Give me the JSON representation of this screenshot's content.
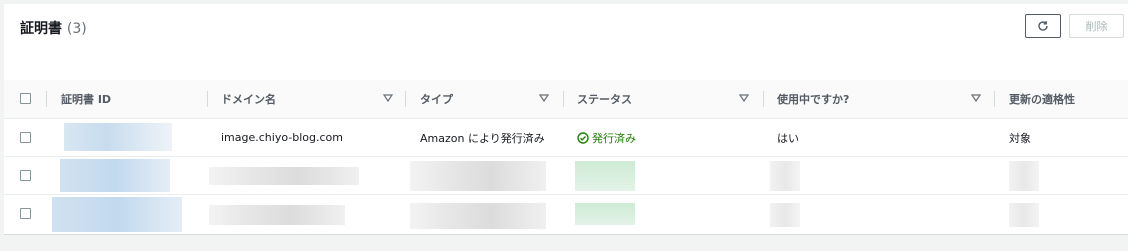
{
  "panel": {
    "title": "証明書",
    "count": "(3)",
    "refresh_icon": "refresh-icon",
    "delete_label": "削除"
  },
  "table": {
    "columns": [
      {
        "label": "証明書 ID",
        "sortable": false
      },
      {
        "label": "ドメイン名",
        "sortable": true
      },
      {
        "label": "タイプ",
        "sortable": true
      },
      {
        "label": "ステータス",
        "sortable": true
      },
      {
        "label": "使用中ですか?",
        "sortable": true
      },
      {
        "label": "更新の適格性",
        "sortable": false
      }
    ],
    "rows": [
      {
        "certificate_id": "",
        "domain": "image.chiyo-blog.com",
        "type": "Amazon により発行済み",
        "status": "発行済み",
        "in_use": "はい",
        "renewal_eligibility": "対象"
      }
    ]
  },
  "colors": {
    "status_ok": "#1d8102",
    "header_bg": "#fafafa",
    "page_bg": "#f2f3f3"
  },
  "icons": {
    "status": "check-circle-icon",
    "sort": "sort-caret-down-icon"
  }
}
